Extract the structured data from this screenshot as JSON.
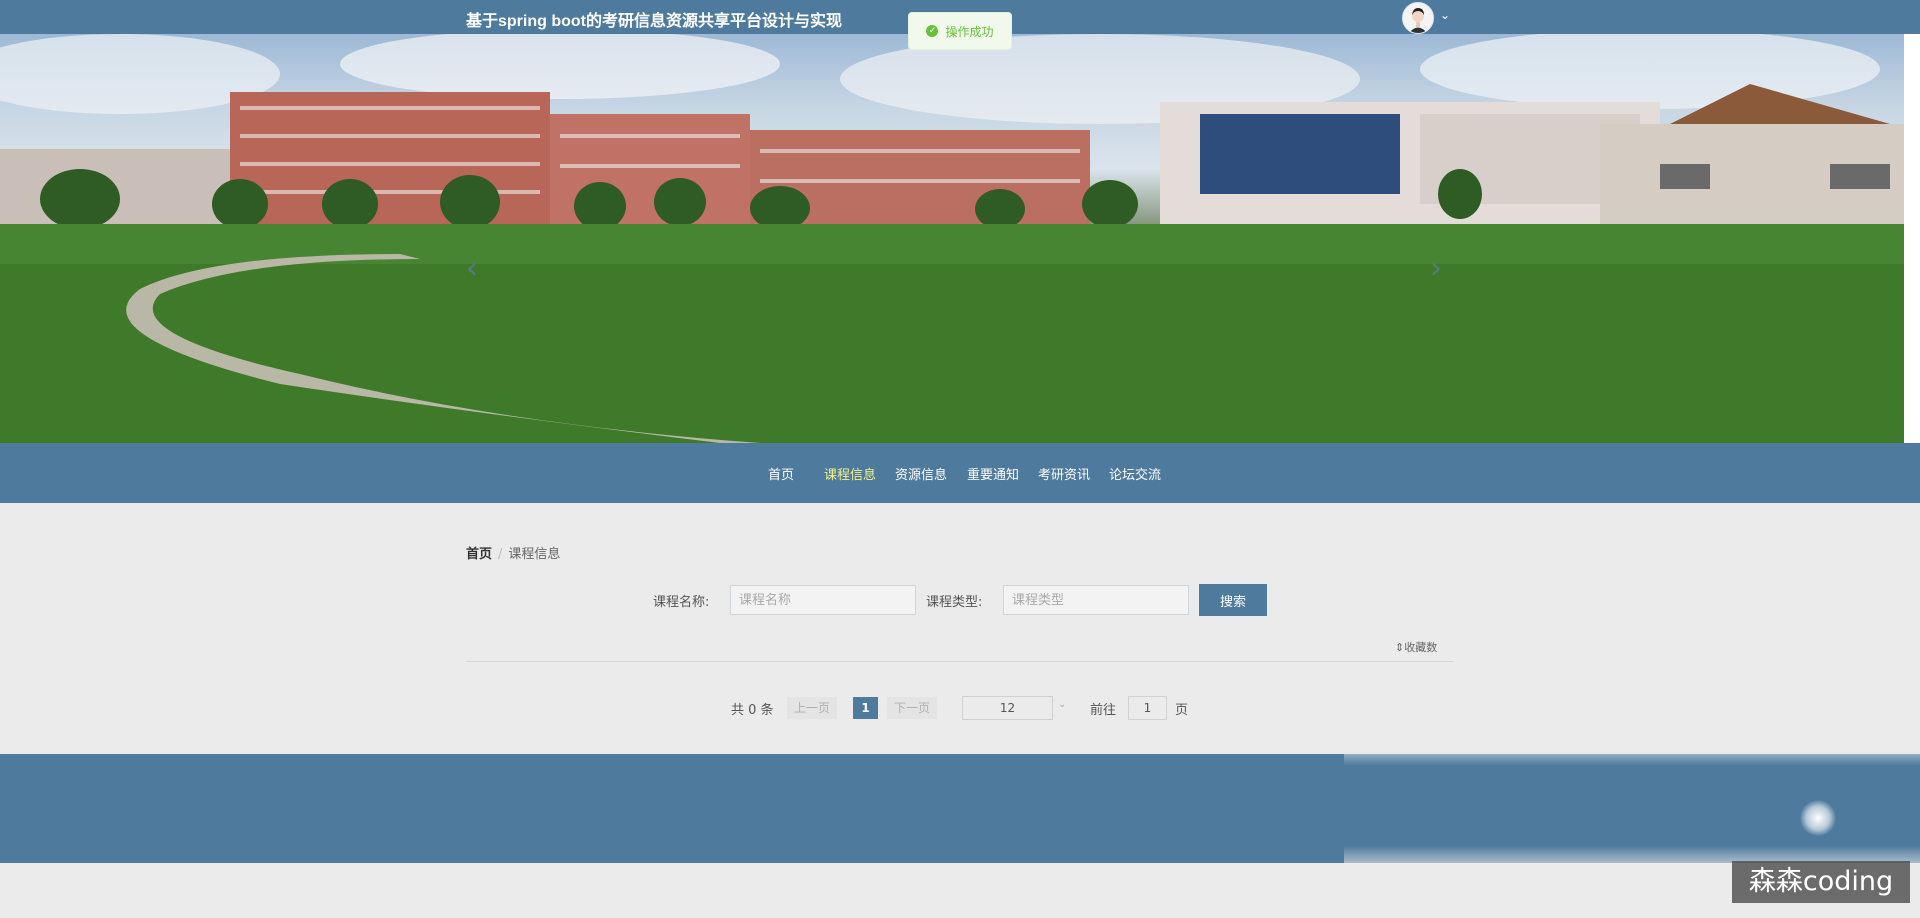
{
  "header": {
    "site_title": "基于spring boot的考研信息资源共享平台设计与实现",
    "avatar_caret": "⌄"
  },
  "toast": {
    "icon": "check-circle-icon",
    "message": "操作成功",
    "color": "#67c23a"
  },
  "banner": {
    "prev_arrow": "‹",
    "next_arrow": "›"
  },
  "nav": {
    "items": [
      {
        "label": "首页",
        "active": false
      },
      {
        "label": "课程信息",
        "active": true
      },
      {
        "label": "资源信息",
        "active": false
      },
      {
        "label": "重要通知",
        "active": false
      },
      {
        "label": "考研资讯",
        "active": false
      },
      {
        "label": "论坛交流",
        "active": false
      }
    ],
    "active_color": "#f2f28a"
  },
  "breadcrumb": {
    "home": "首页",
    "separator": "/",
    "current": "课程信息"
  },
  "search": {
    "name_label": "课程名称:",
    "name_placeholder": "课程名称",
    "type_label": "课程类型:",
    "type_placeholder": "课程类型",
    "button": "搜索"
  },
  "sort": {
    "label": "⇕收藏数"
  },
  "pagination": {
    "total_text": "共 0 条",
    "prev": "上一页",
    "current_page": "1",
    "next": "下一页",
    "page_size": "12",
    "size_caret": "⌄",
    "goto_label": "前往",
    "goto_value": "1",
    "page_word": "页"
  },
  "watermark": "森森coding",
  "colors": {
    "primary": "#4e7a9e",
    "background": "#ebebeb"
  }
}
